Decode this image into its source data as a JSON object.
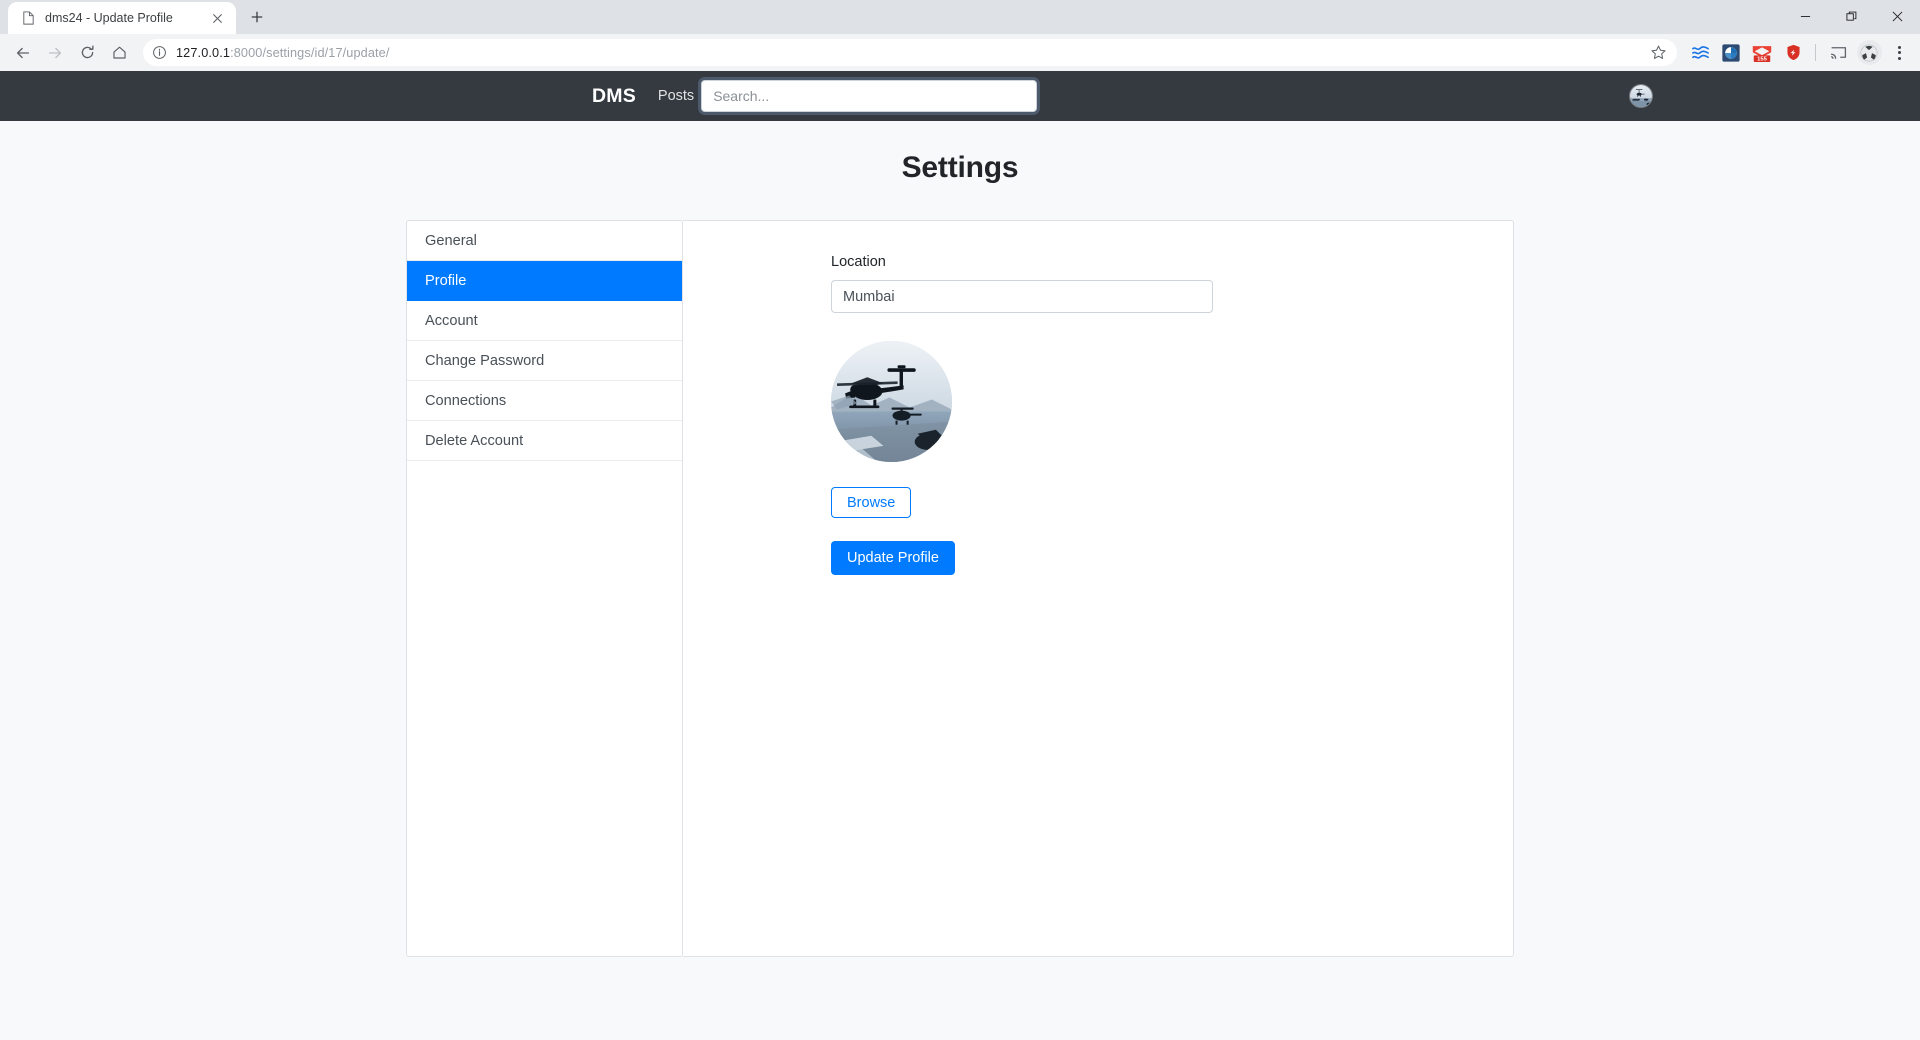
{
  "browser": {
    "tab": {
      "title": "dms24 - Update Profile",
      "favicon_icon": "page-icon",
      "close_icon": "close-icon"
    },
    "new_tab_icon": "plus-icon",
    "window_controls": {
      "minimize_icon": "minimize-icon",
      "maximize_icon": "restore-icon",
      "close_icon": "window-close-icon"
    },
    "toolbar": {
      "back_icon": "back-arrow-icon",
      "forward_icon": "forward-arrow-icon",
      "reload_icon": "reload-icon",
      "home_icon": "home-icon",
      "site_info_icon": "info-circle-icon",
      "bookmark_icon": "star-icon",
      "url_host": "127.0.0.1",
      "url_path": ":8000/settings/id/17/update/",
      "url_full": "127.0.0.1:8000/settings/id/17/update/",
      "extensions": [
        {
          "name": "wave-lines-extension-icon",
          "badge": ""
        },
        {
          "name": "blue-circle-extension-icon",
          "badge": ""
        },
        {
          "name": "gmail-extension-icon",
          "badge": "155"
        },
        {
          "name": "shield-extension-icon",
          "badge": ""
        }
      ],
      "cast_icon": "cast-icon",
      "profile_icon": "browser-profile-avatar",
      "menu_icon": "three-dot-menu-icon"
    }
  },
  "navbar": {
    "brand": "DMS",
    "posts_link": "Posts",
    "search": {
      "placeholder": "Search...",
      "value": ""
    },
    "avatar_icon": "user-avatar"
  },
  "page": {
    "title": "Settings"
  },
  "sidebar": {
    "items": [
      {
        "label": "General",
        "active": false
      },
      {
        "label": "Profile",
        "active": true
      },
      {
        "label": "Account",
        "active": false
      },
      {
        "label": "Change Password",
        "active": false
      },
      {
        "label": "Connections",
        "active": false
      },
      {
        "label": "Delete Account",
        "active": false
      }
    ]
  },
  "form": {
    "location": {
      "label": "Location",
      "value": "Mumbai"
    },
    "profile_image_alt": "profile-photo-helicopters-over-water",
    "browse_button": "Browse",
    "submit_button": "Update Profile"
  },
  "colors": {
    "navbar_bg": "#343a40",
    "accent_blue": "#007bff",
    "page_bg": "#f8f9fa",
    "card_border": "#dee2e6",
    "badge_red": "#d93025"
  }
}
